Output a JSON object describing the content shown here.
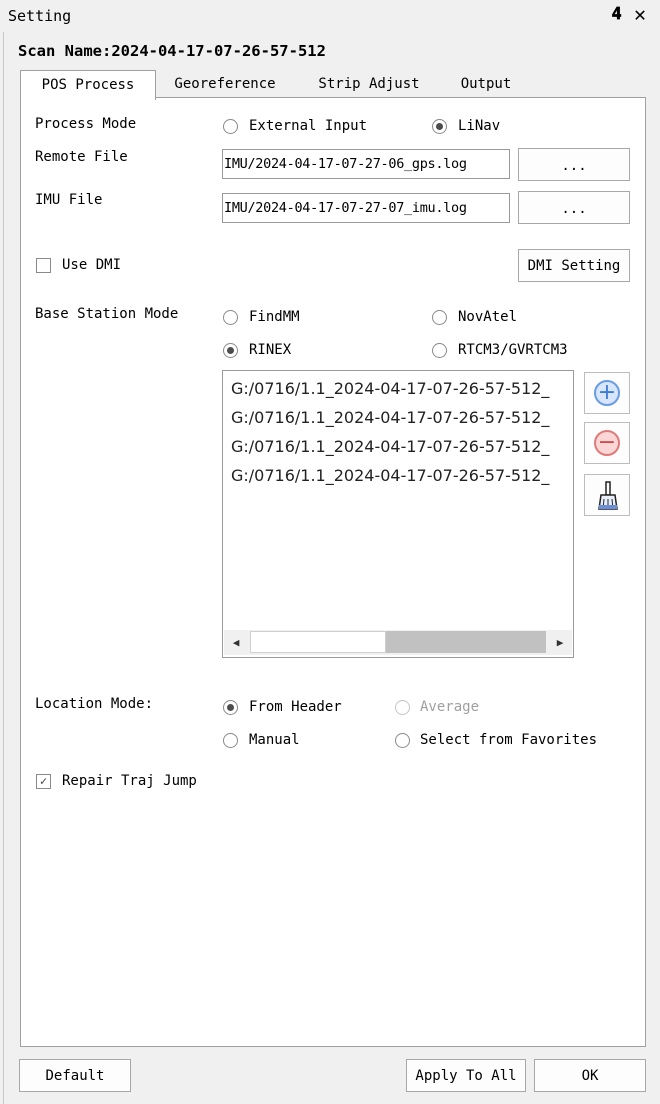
{
  "window": {
    "title": "Setting",
    "pin_icon": "pin-icon",
    "close_icon": "close-icon",
    "scan_name": "Scan Name:2024-04-17-07-26-57-512"
  },
  "tabs": [
    {
      "label": "POS Process",
      "active": true
    },
    {
      "label": "Georeference",
      "active": false
    },
    {
      "label": "Strip Adjust",
      "active": false
    },
    {
      "label": "Output",
      "active": false
    }
  ],
  "process_mode": {
    "label": "Process Mode",
    "options": [
      {
        "label": "External Input",
        "checked": false
      },
      {
        "label": "LiNav",
        "checked": true
      }
    ]
  },
  "remote_file": {
    "label": "Remote File",
    "value": "IMU/2024-04-17-07-27-06_gps.log",
    "browse_label": "..."
  },
  "imu_file": {
    "label": "IMU File",
    "value": "IMU/2024-04-17-07-27-07_imu.log",
    "browse_label": "..."
  },
  "dmi": {
    "checkbox_label": "Use DMI",
    "checked": false,
    "settings_button": "DMI Setting"
  },
  "base_station": {
    "label": "Base Station Mode",
    "options": [
      {
        "label": "FindMM",
        "checked": false
      },
      {
        "label": "NovAtel",
        "checked": false
      },
      {
        "label": "RINEX",
        "checked": true
      },
      {
        "label": "RTCM3/GVRTCM3",
        "checked": false
      }
    ],
    "files": [
      "G:/0716/1.1_2024-04-17-07-26-57-512_",
      "G:/0716/1.1_2024-04-17-07-26-57-512_",
      "G:/0716/1.1_2024-04-17-07-26-57-512_",
      "G:/0716/1.1_2024-04-17-07-26-57-512_"
    ],
    "add_icon": "plus-circle-icon",
    "remove_icon": "minus-circle-icon",
    "clear_icon": "broom-icon"
  },
  "location_mode": {
    "label": "Location Mode:",
    "options": [
      {
        "label": "From Header",
        "checked": true,
        "enabled": true
      },
      {
        "label": "Average",
        "checked": false,
        "enabled": false
      },
      {
        "label": "Manual",
        "checked": false,
        "enabled": true
      },
      {
        "label": "Select from Favorites",
        "checked": false,
        "enabled": true
      }
    ]
  },
  "repair_traj": {
    "label": "Repair Traj Jump",
    "checked": true
  },
  "footer": {
    "default_button": "Default",
    "apply_all_button": "Apply To All",
    "ok_button": "OK"
  }
}
